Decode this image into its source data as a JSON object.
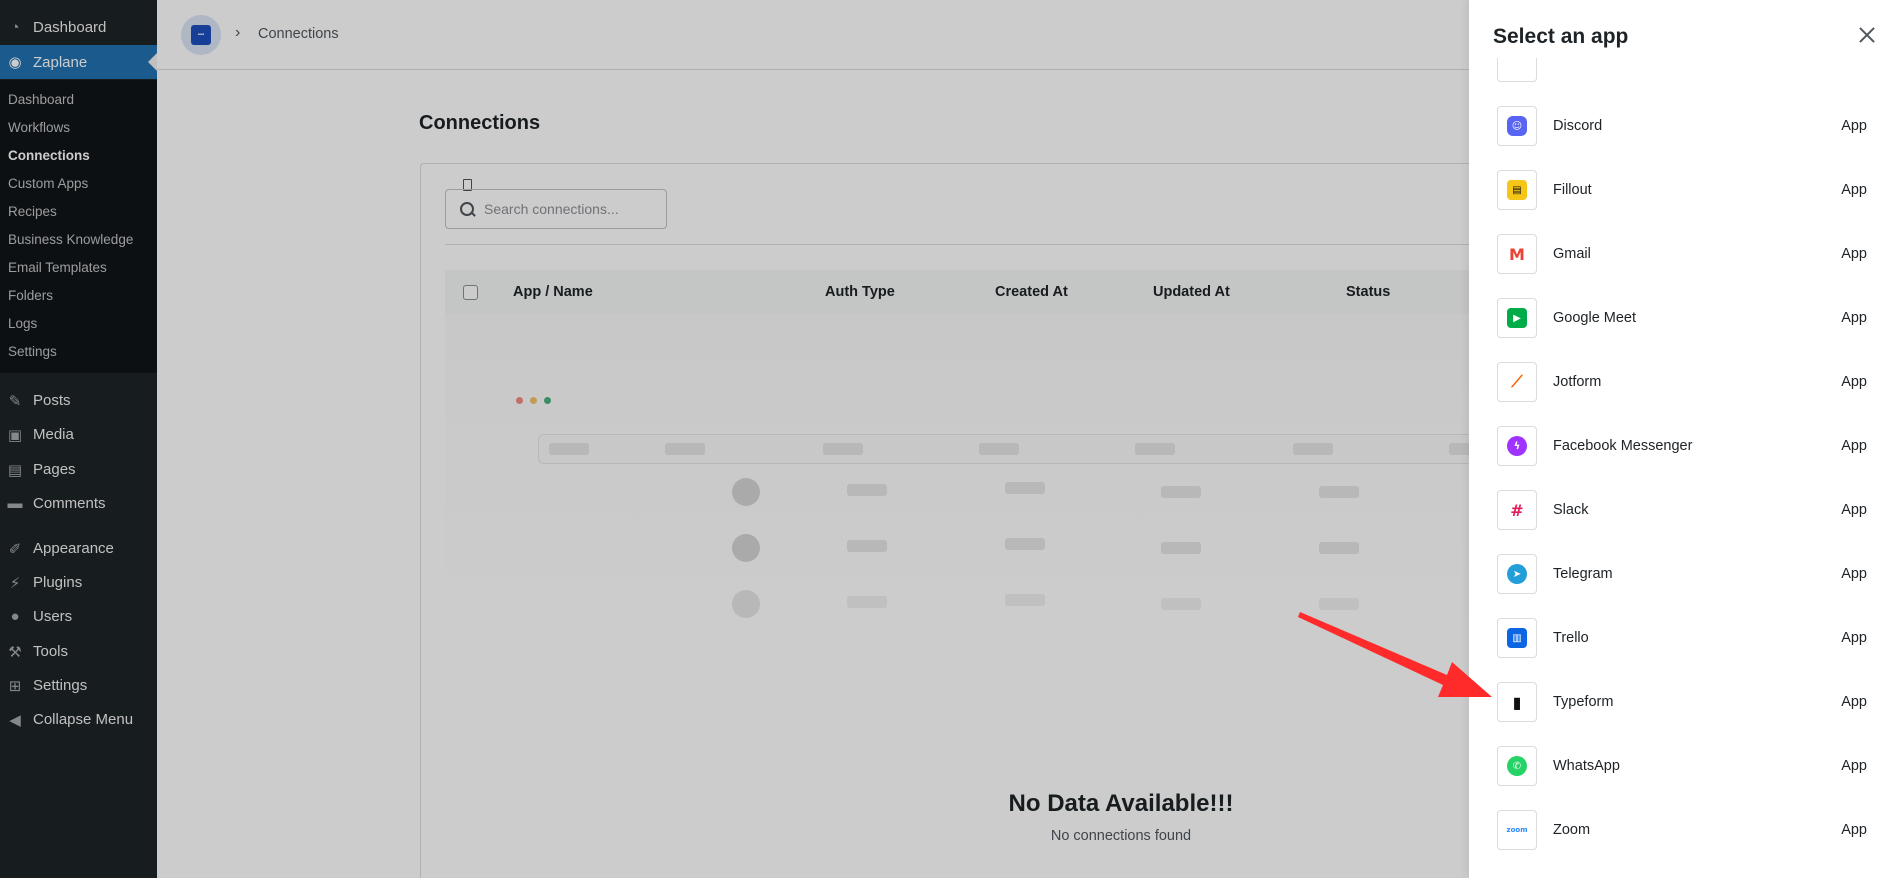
{
  "wp_menu": {
    "dashboard": "Dashboard",
    "zaplane": "Zaplane",
    "submenu": [
      "Dashboard",
      "Workflows",
      "Connections",
      "Custom Apps",
      "Recipes",
      "Business Knowledge",
      "Email Templates",
      "Folders",
      "Logs",
      "Settings"
    ],
    "posts": "Posts",
    "media": "Media",
    "pages": "Pages",
    "comments": "Comments",
    "appearance": "Appearance",
    "plugins": "Plugins",
    "users": "Users",
    "tools": "Tools",
    "settings": "Settings",
    "collapse": "Collapse Menu"
  },
  "breadcrumb": {
    "current": "Connections"
  },
  "page": {
    "title": "Connections",
    "search_placeholder": "Search connections...",
    "columns": [
      "App / Name",
      "Auth Type",
      "Created At",
      "Updated At",
      "Status"
    ],
    "empty_title": "No Data Available!!!",
    "empty_subtitle": "No connections found"
  },
  "drawer": {
    "title": "Select an app",
    "apps": [
      {
        "name": "Discord",
        "type": "App",
        "icon": "discord-icon",
        "color": "#5865F2"
      },
      {
        "name": "Fillout",
        "type": "App",
        "icon": "fillout-icon",
        "color": "#F5C518"
      },
      {
        "name": "Gmail",
        "type": "App",
        "icon": "gmail-icon",
        "color": "#EA4335"
      },
      {
        "name": "Google Meet",
        "type": "App",
        "icon": "google-meet-icon",
        "color": "#00AC47"
      },
      {
        "name": "Jotform",
        "type": "App",
        "icon": "jotform-icon",
        "color": "#FF6100"
      },
      {
        "name": "Facebook Messenger",
        "type": "App",
        "icon": "messenger-icon",
        "color": "#A033FF"
      },
      {
        "name": "Slack",
        "type": "App",
        "icon": "slack-icon",
        "color": "#E01E5A"
      },
      {
        "name": "Telegram",
        "type": "App",
        "icon": "telegram-icon",
        "color": "#229ED9"
      },
      {
        "name": "Trello",
        "type": "App",
        "icon": "trello-icon",
        "color": "#0C66E4"
      },
      {
        "name": "Typeform",
        "type": "App",
        "icon": "typeform-icon",
        "color": "#111111"
      },
      {
        "name": "WhatsApp",
        "type": "App",
        "icon": "whatsapp-icon",
        "color": "#25D366"
      },
      {
        "name": "Zoom",
        "type": "App",
        "icon": "zoom-icon",
        "color": "#2D8CFF"
      }
    ]
  },
  "annotation": {
    "arrow_color": "#FF2A2A"
  }
}
